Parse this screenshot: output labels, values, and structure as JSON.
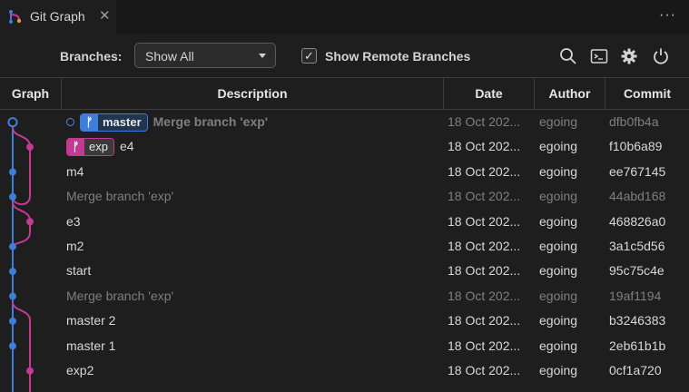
{
  "tab": {
    "title": "Git Graph",
    "close": "✕",
    "more": "···"
  },
  "controls": {
    "branches_label": "Branches:",
    "branch_select_value": "Show All",
    "show_remote_label": "Show Remote Branches",
    "show_remote_checked": true
  },
  "columns": [
    "Graph",
    "Description",
    "Date",
    "Author",
    "Commit"
  ],
  "colors": {
    "master": "#3e7ed8",
    "exp": "#c43a93",
    "background": "#1e1e1e"
  },
  "rows": [
    {
      "head": true,
      "refs": [
        {
          "name": "master",
          "kind": "master"
        }
      ],
      "description": "Merge branch 'exp'",
      "date": "18 Oct 202...",
      "author": "egoing",
      "commit": "dfb0fb4a",
      "dim": true,
      "bold": true
    },
    {
      "refs": [
        {
          "name": "exp",
          "kind": "exp"
        }
      ],
      "description": "e4",
      "date": "18 Oct 202...",
      "author": "egoing",
      "commit": "f10b6a89",
      "dim": false
    },
    {
      "refs": [],
      "description": "m4",
      "date": "18 Oct 202...",
      "author": "egoing",
      "commit": "ee767145",
      "dim": false
    },
    {
      "refs": [],
      "description": "Merge branch 'exp'",
      "date": "18 Oct 202...",
      "author": "egoing",
      "commit": "44abd168",
      "dim": true
    },
    {
      "refs": [],
      "description": "e3",
      "date": "18 Oct 202...",
      "author": "egoing",
      "commit": "468826a0",
      "dim": false
    },
    {
      "refs": [],
      "description": "m2",
      "date": "18 Oct 202...",
      "author": "egoing",
      "commit": "3a1c5d56",
      "dim": false
    },
    {
      "refs": [],
      "description": "start",
      "date": "18 Oct 202...",
      "author": "egoing",
      "commit": "95c75c4e",
      "dim": false
    },
    {
      "refs": [],
      "description": "Merge branch 'exp'",
      "date": "18 Oct 202...",
      "author": "egoing",
      "commit": "19af1194",
      "dim": true
    },
    {
      "refs": [],
      "description": "master 2",
      "date": "18 Oct 202...",
      "author": "egoing",
      "commit": "b3246383",
      "dim": false
    },
    {
      "refs": [],
      "description": "master 1",
      "date": "18 Oct 202...",
      "author": "egoing",
      "commit": "2eb61b1b",
      "dim": false
    },
    {
      "refs": [],
      "description": "exp2",
      "date": "18 Oct 202...",
      "author": "egoing",
      "commit": "0cf1a720",
      "dim": false
    }
  ]
}
